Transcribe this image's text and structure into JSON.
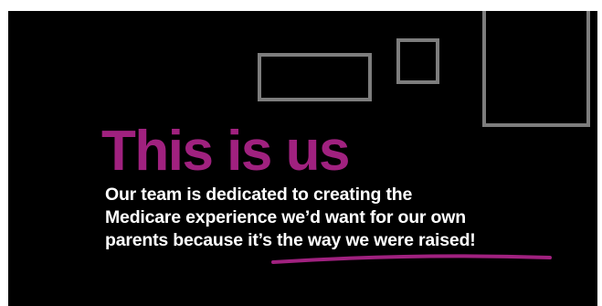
{
  "banner": {
    "title": "This is us",
    "body_lines": [
      "Our team is dedicated to creating the",
      "Medicare experience we’d want for our own",
      "parents because it’s the way we were raised!"
    ]
  },
  "colors": {
    "background": "#000000",
    "title": "#a0217f",
    "body_text": "#ffffff",
    "frames": "#7d7d7d",
    "underline": "#a0217f",
    "page": "#ffffff"
  }
}
